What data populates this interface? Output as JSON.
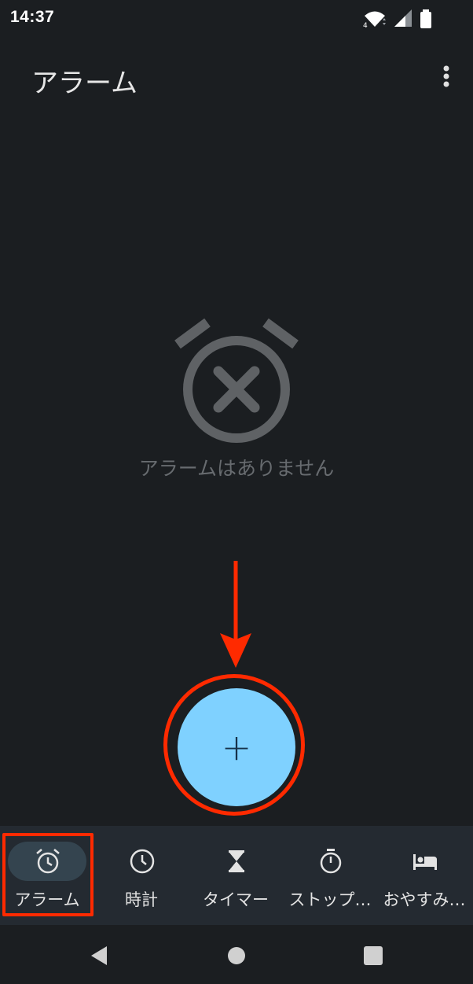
{
  "status_bar": {
    "time": "14:37",
    "network_label": "4"
  },
  "app_bar": {
    "title": "アラーム",
    "overflow_icon": "more-vert-icon"
  },
  "empty_state": {
    "icon": "alarm-off-icon",
    "message": "アラームはありません"
  },
  "fab": {
    "label": "+",
    "icon": "add-icon"
  },
  "annotation": {
    "color": "#ff2a00"
  },
  "bottom_nav": {
    "items": [
      {
        "label": "アラーム",
        "icon": "alarm-icon",
        "selected": true
      },
      {
        "label": "時計",
        "icon": "clock-icon",
        "selected": false
      },
      {
        "label": "タイマー",
        "icon": "hourglass-icon",
        "selected": false
      },
      {
        "label": "ストップ…",
        "icon": "stopwatch-icon",
        "selected": false
      },
      {
        "label": "おやすみ…",
        "icon": "bed-icon",
        "selected": false
      }
    ]
  },
  "system_nav": {
    "back": "back-icon",
    "home": "home-icon",
    "recents": "recents-icon"
  },
  "colors": {
    "background": "#1b1e21",
    "nav_background": "#242a31",
    "fab": "#7fd1ff",
    "selected_pill": "#34444f",
    "empty_icon": "#5f6265"
  }
}
